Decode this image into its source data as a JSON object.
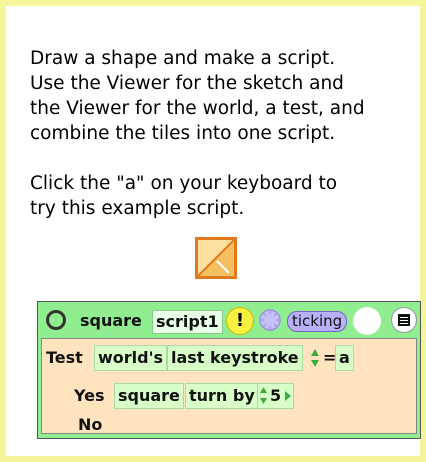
{
  "instructions": {
    "line1": "Draw a shape and make a script.",
    "line2": "Use the Viewer for the sketch and",
    "line3": "the Viewer for the world, a test, and",
    "line4": "combine the tiles into one script.",
    "line5": "Click the \"a\" on your keyboard to",
    "line6": "try this example script."
  },
  "sketch": {
    "icon": "sketch-square-icon",
    "fill": "#f4c060",
    "border": "#e07a1c"
  },
  "script": {
    "object_name": "square",
    "script_name": "script1",
    "bang_label": "!",
    "status": "ticking",
    "test_label": "Test",
    "world_tile": "world's",
    "keystroke_tile": "last keystroke",
    "operator": "=",
    "key_value": "a",
    "yes_label": "Yes",
    "yes_object": "square",
    "yes_command": "turn by",
    "yes_amount": "5",
    "no_label": "No"
  },
  "colors": {
    "background": "#f5f59a",
    "script_header": "#90ee90",
    "test_body": "#ffe4bf",
    "status_pill": "#b8b0f8"
  }
}
